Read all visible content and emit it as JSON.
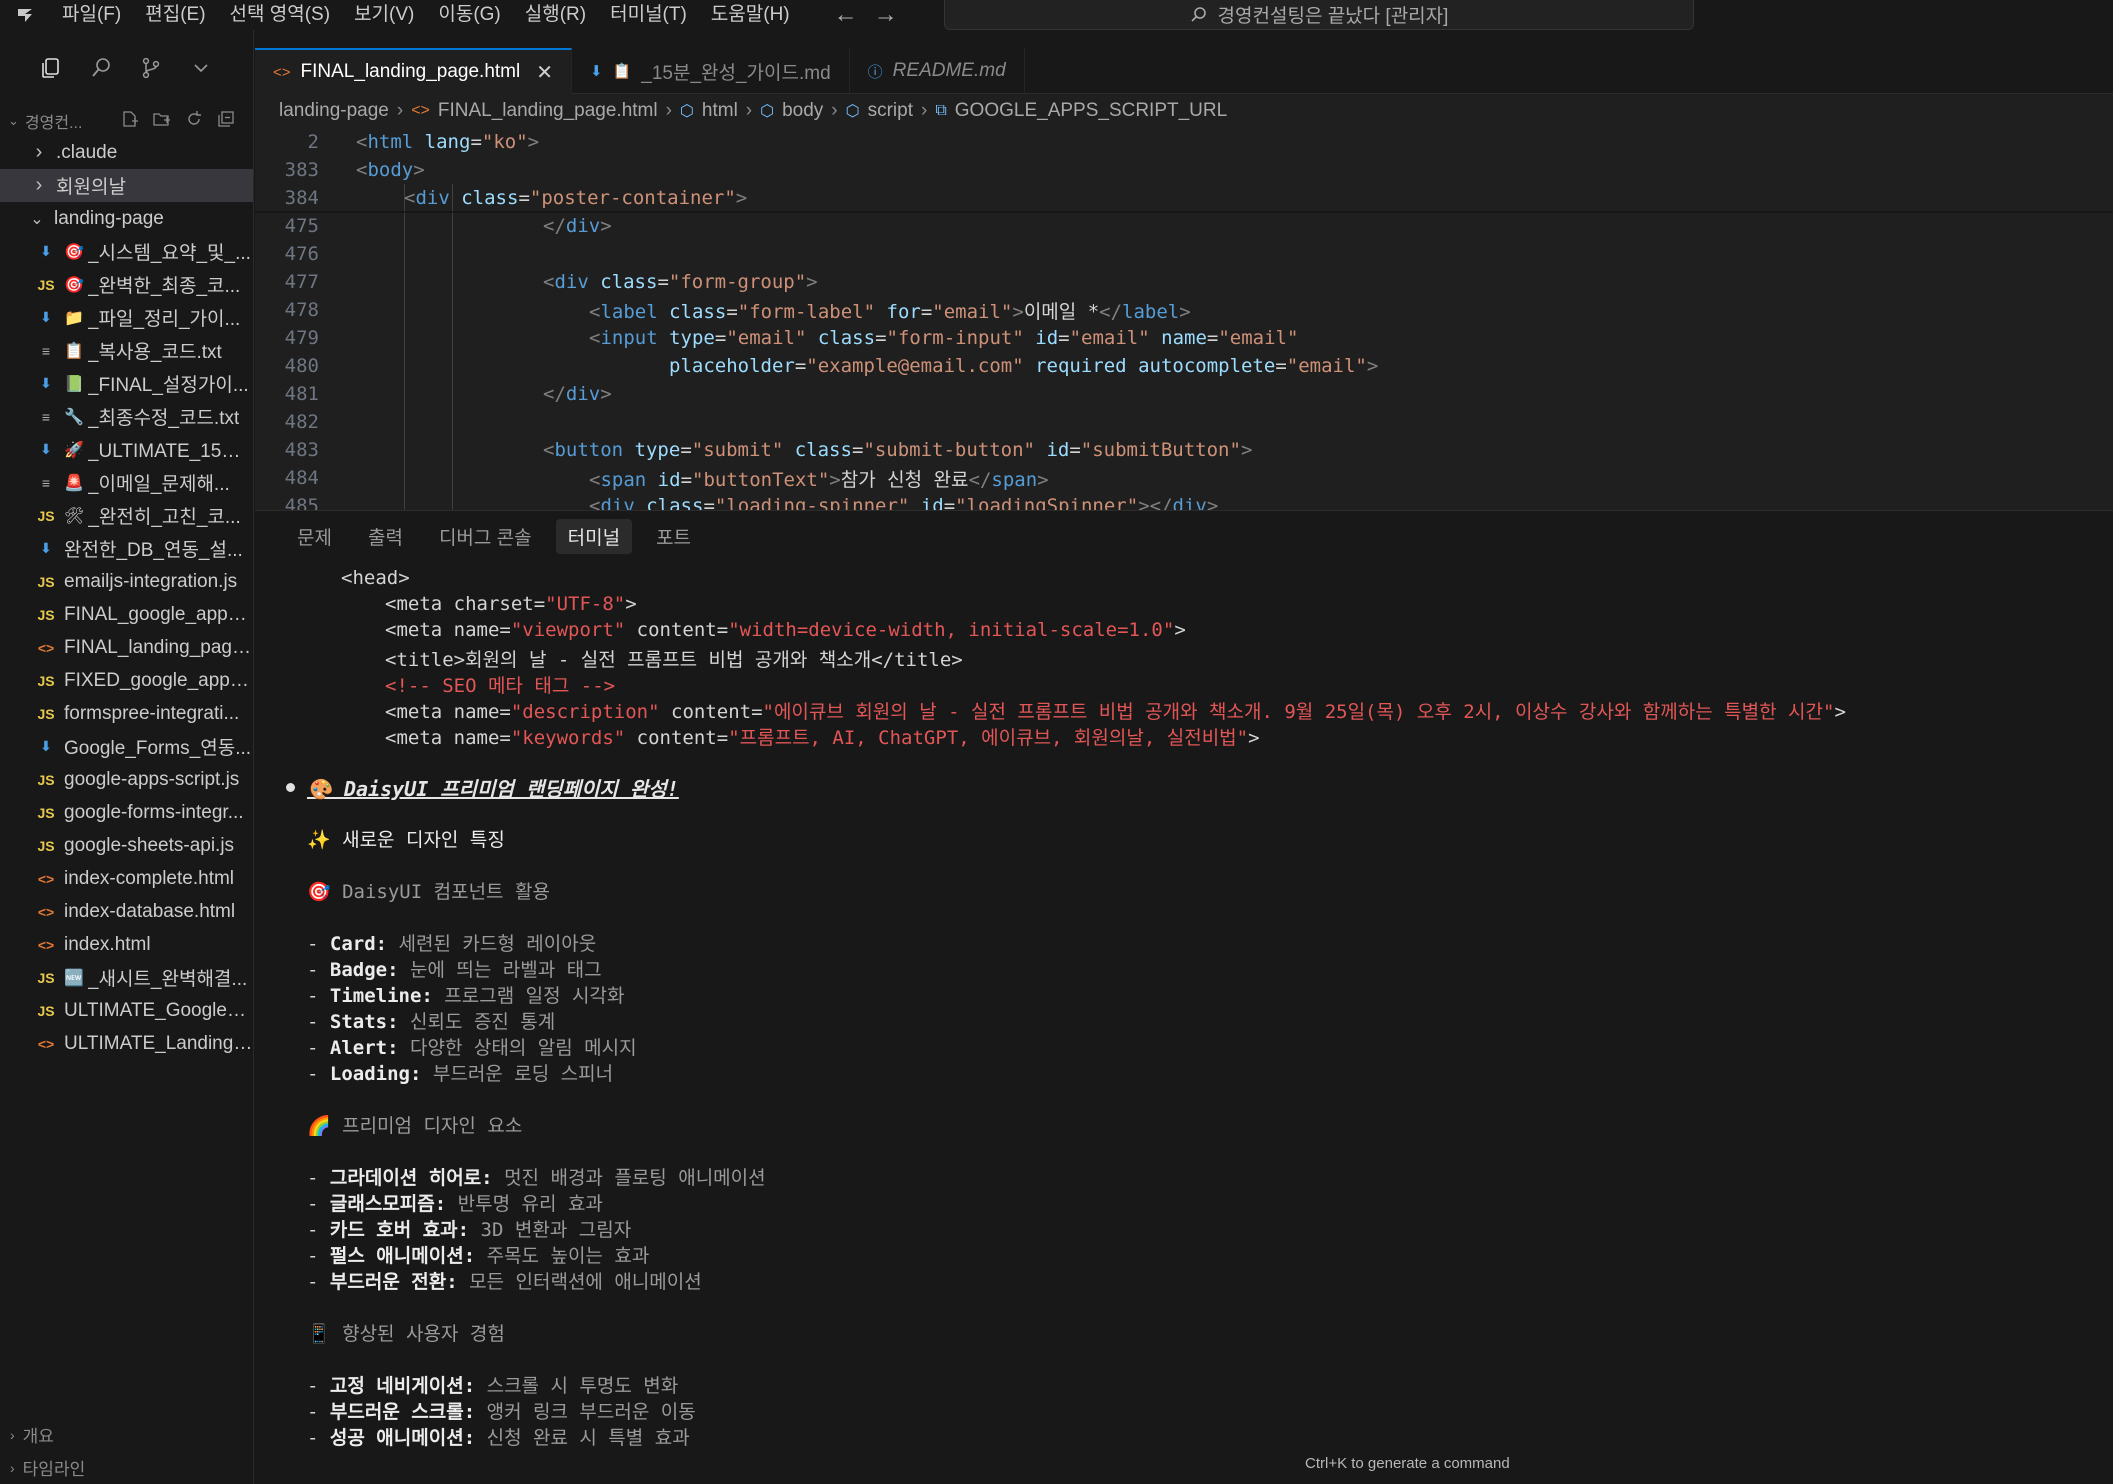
{
  "menu": {
    "items": [
      "파일(F)",
      "편집(E)",
      "선택 영역(S)",
      "보기(V)",
      "이동(G)",
      "실행(R)",
      "터미널(T)",
      "도움말(H)"
    ],
    "search_text": "경영컨설팅은 끝났다 [관리자]"
  },
  "explorer": {
    "root_label": "경영컨...",
    "items": [
      {
        "label": ".claude",
        "kind": "folder",
        "expanded": false
      },
      {
        "label": "회원의날",
        "kind": "folder",
        "expanded": false,
        "selected": true
      },
      {
        "label": "landing-page",
        "kind": "folder",
        "expanded": true
      },
      {
        "label": "_시스템_요약_및_...",
        "kind": "md",
        "emoji": "🎯"
      },
      {
        "label": "_완벽한_최종_코...",
        "kind": "js",
        "emoji": "🎯"
      },
      {
        "label": "_파일_정리_가이...",
        "kind": "md",
        "emoji": "📁"
      },
      {
        "label": "_복사용_코드.txt",
        "kind": "txt",
        "emoji": "📋"
      },
      {
        "label": "_FINAL_설정가이...",
        "kind": "md",
        "emoji": "📗"
      },
      {
        "label": "_최종수정_코드.txt",
        "kind": "txt",
        "emoji": "🔧"
      },
      {
        "label": "_ULTIMATE_15분...",
        "kind": "md",
        "emoji": "🚀"
      },
      {
        "label": "_이메일_문제해...",
        "kind": "txt",
        "emoji": "🚨"
      },
      {
        "label": "_완전히_고친_코...",
        "kind": "js",
        "emoji": "🛠"
      },
      {
        "label": "완전한_DB_연동_설...",
        "kind": "md",
        "emoji": ""
      },
      {
        "label": "emailjs-integration.js",
        "kind": "js",
        "emoji": ""
      },
      {
        "label": "FINAL_google_apps_...",
        "kind": "js",
        "emoji": ""
      },
      {
        "label": "FINAL_landing_page....",
        "kind": "html",
        "emoji": ""
      },
      {
        "label": "FIXED_google_apps_...",
        "kind": "js",
        "emoji": ""
      },
      {
        "label": "formspree-integrati...",
        "kind": "js",
        "emoji": ""
      },
      {
        "label": "Google_Forms_연동...",
        "kind": "md",
        "emoji": ""
      },
      {
        "label": "google-apps-script.js",
        "kind": "js",
        "emoji": ""
      },
      {
        "label": "google-forms-integr...",
        "kind": "js",
        "emoji": ""
      },
      {
        "label": "google-sheets-api.js",
        "kind": "js",
        "emoji": ""
      },
      {
        "label": "index-complete.html",
        "kind": "html",
        "emoji": ""
      },
      {
        "label": "index-database.html",
        "kind": "html",
        "emoji": ""
      },
      {
        "label": "index.html",
        "kind": "html",
        "emoji": ""
      },
      {
        "label": "_새시트_완벽해결...",
        "kind": "js",
        "emoji": "🆕"
      },
      {
        "label": "ULTIMATE_Google_A...",
        "kind": "js",
        "emoji": ""
      },
      {
        "label": "ULTIMATE_Landing_...",
        "kind": "html",
        "emoji": ""
      }
    ],
    "bottom_sections": [
      "개요",
      "타임라인"
    ]
  },
  "tabs": [
    {
      "label": "FINAL_landing_page.html",
      "icon": "<>",
      "active": true
    },
    {
      "label": "_15분_완성_가이드.md",
      "icon": "⬇",
      "active": false
    },
    {
      "label": "README.md",
      "icon": "ⓘ",
      "active": false
    }
  ],
  "breadcrumb": [
    "landing-page",
    "FINAL_landing_page.html",
    "html",
    "body",
    "script",
    "GOOGLE_APPS_SCRIPT_URL"
  ],
  "code": {
    "line_numbers": [
      "2",
      "383",
      "384",
      "475",
      "476",
      "477",
      "478",
      "479",
      "480",
      "481",
      "482",
      "483",
      "484",
      "485"
    ]
  },
  "panel": {
    "tabs": [
      "문제",
      "출력",
      "디버그 콘솔",
      "터미널",
      "포트"
    ],
    "active_tab": "터미널",
    "title": "🎨 DaisyUI 프리미엄 랜딩페이지 완성!",
    "section1": "✨ 새로운 디자인 특징",
    "section2": "🎯 DaisyUI 컴포넌트 활용",
    "components": [
      {
        "name": "Card",
        "desc": " 세련된 카드형 레이아웃"
      },
      {
        "name": "Badge",
        "desc": " 눈에 띄는 라벨과 태그"
      },
      {
        "name": "Timeline",
        "desc": " 프로그램 일정 시각화"
      },
      {
        "name": "Stats",
        "desc": " 신뢰도 증진 통계"
      },
      {
        "name": "Alert",
        "desc": " 다양한 상태의 알림 메시지"
      },
      {
        "name": "Loading",
        "desc": " 부드러운 로딩 스피너"
      }
    ],
    "section3": "🌈 프리미엄 디자인 요소",
    "design": [
      {
        "name": "그라데이션 히어로",
        "desc": " 멋진 배경과 플로팅 애니메이션"
      },
      {
        "name": "글래스모피즘",
        "desc": " 반투명 유리 효과"
      },
      {
        "name": "카드 호버 효과",
        "desc": " 3D 변환과 그림자"
      },
      {
        "name": "펄스 애니메이션",
        "desc": " 주목도 높이는 효과"
      },
      {
        "name": "부드러운 전환",
        "desc": " 모든 인터랙션에 애니메이션"
      }
    ],
    "section4": "📱 향상된 사용자 경험",
    "ux": [
      {
        "name": "고정 네비게이션",
        "desc": " 스크롤 시 투명도 변화"
      },
      {
        "name": "부드러운 스크롤",
        "desc": " 앵커 링크 부드러운 이동"
      },
      {
        "name": "성공 애니메이션",
        "desc": " 신청 완료 시 특별 효과"
      }
    ],
    "hint": "Ctrl+K to generate a command"
  }
}
